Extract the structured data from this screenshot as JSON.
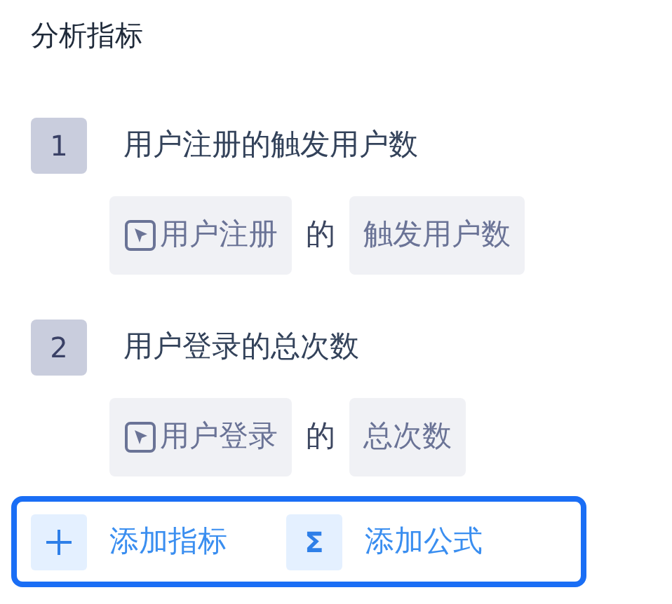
{
  "section_title": "分析指标",
  "metrics": [
    {
      "index": "1",
      "name": "用户注册的触发用户数",
      "event": "用户注册",
      "connector": "的",
      "property": "触发用户数"
    },
    {
      "index": "2",
      "name": "用户登录的总次数",
      "event": "用户登录",
      "connector": "的",
      "property": "总次数"
    }
  ],
  "actions": [
    {
      "kind": "plus",
      "label": "添加指标"
    },
    {
      "kind": "symbol",
      "symbol": "Σ",
      "label": "添加公式"
    }
  ]
}
